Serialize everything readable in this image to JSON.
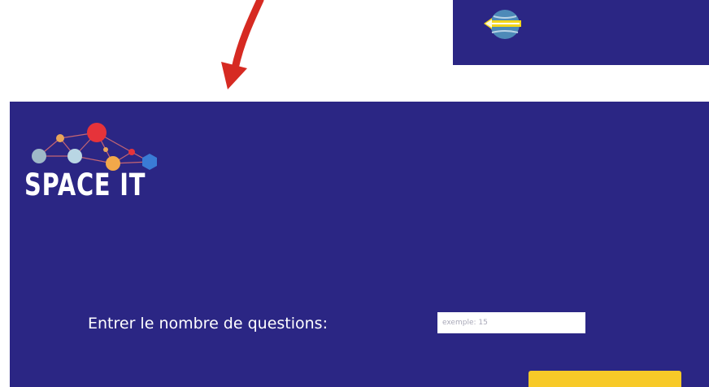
{
  "logo": {
    "text": "SPACE IT"
  },
  "form": {
    "label": "Entrer le nombre de questions:",
    "input_placeholder": "exemple: 15",
    "input_value": ""
  },
  "colors": {
    "panel_background": "#2b2684",
    "start_button": "#f7c928",
    "arrow": "#d62a22",
    "globe_band": "#f3d61a"
  },
  "icons": {
    "arrow": "curved-arrow-down-icon",
    "globe": "globe-back-icon",
    "logo_graphic": "planet-network-icon"
  }
}
